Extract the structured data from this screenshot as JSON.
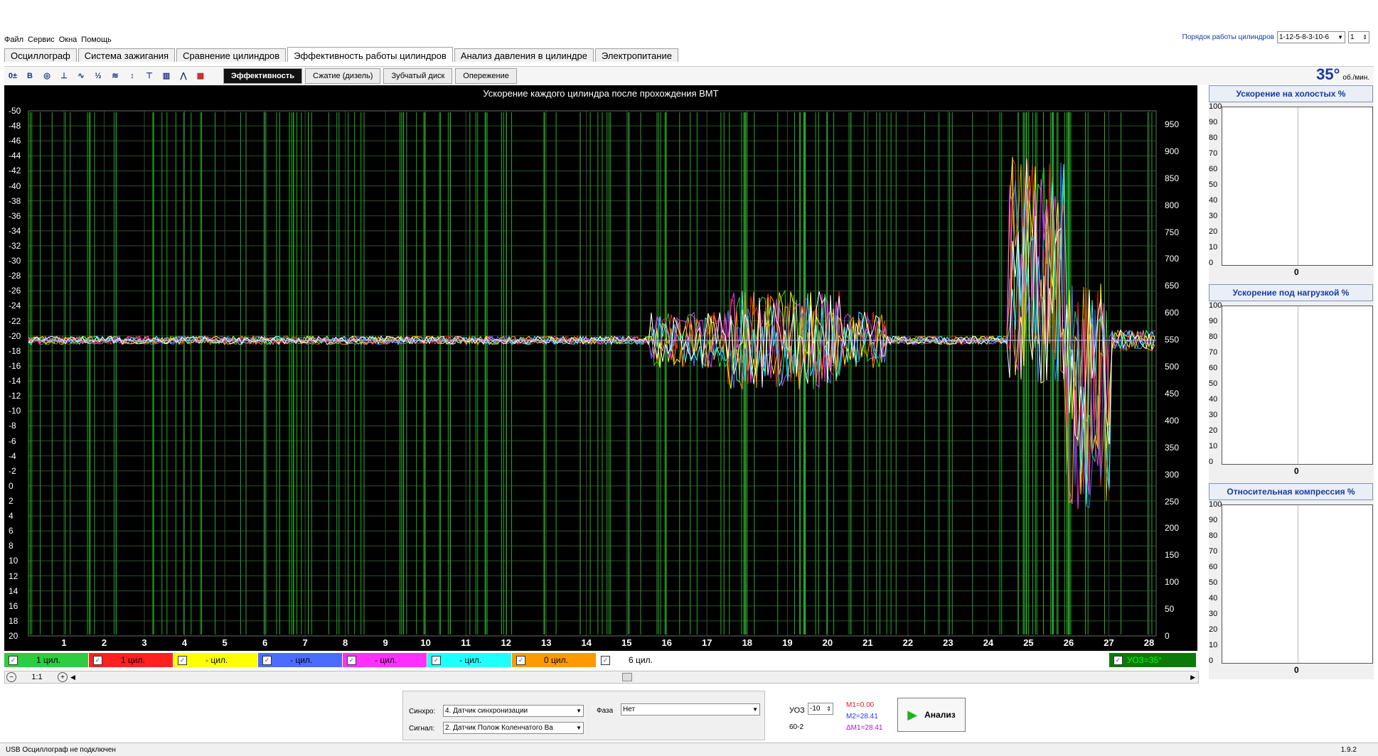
{
  "menu": [
    "Файл",
    "Сервис",
    "Окна",
    "Помощь"
  ],
  "cyl_order": {
    "label": "Порядок работы цилиндров",
    "value": "1-12-5-8-3-10-6",
    "spin": "1"
  },
  "tabs": [
    "Осциллограф",
    "Система зажигания",
    "Сравнение цилиндров",
    "Эффективность работы цилиндров",
    "Анализ давления в цилиндре",
    "Электропитание"
  ],
  "active_tab": 3,
  "subtabs": [
    "Эффективность",
    "Сжатие (дизель)",
    "Зубчатый диск",
    "Опережение"
  ],
  "angle": {
    "value": "35°",
    "unit": "об./мин."
  },
  "chart_data": {
    "type": "line",
    "title": "Ускорение каждого цилиндра после прохождения ВМТ",
    "x_ticks": [
      "1",
      "2",
      "3",
      "4",
      "5",
      "6",
      "7",
      "8",
      "9",
      "10",
      "11",
      "12",
      "13",
      "14",
      "15",
      "16",
      "17",
      "18",
      "19",
      "20",
      "21",
      "22",
      "23",
      "24",
      "25",
      "26",
      "27",
      "28"
    ],
    "left_ticks": [
      "-50",
      "-48",
      "-46",
      "-44",
      "-42",
      "-40",
      "-38",
      "-36",
      "-34",
      "-32",
      "-30",
      "-28",
      "-26",
      "-24",
      "-22",
      "-20",
      "-18",
      "-16",
      "-14",
      "-12",
      "-10",
      "-8",
      "-6",
      "-4",
      "-2",
      "0",
      "2",
      "4",
      "6",
      "8",
      "10",
      "12",
      "14",
      "16",
      "18",
      "20"
    ],
    "right_ticks": [
      "950",
      "900",
      "850",
      "800",
      "750",
      "700",
      "650",
      "600",
      "550",
      "500",
      "450",
      "400",
      "350",
      "300",
      "250",
      "200",
      "150",
      "100",
      "50",
      "0"
    ],
    "ylim_left": [
      -50,
      20
    ],
    "ylim_right": [
      0,
      975
    ],
    "grid": true,
    "series": [
      {
        "color": "#2ecc40"
      },
      {
        "color": "#ff2020"
      },
      {
        "color": "#ffff00"
      },
      {
        "color": "#4a6cff"
      },
      {
        "color": "#ff30ff"
      },
      {
        "color": "#20ffff"
      },
      {
        "color": "#ff9900"
      },
      {
        "color": "#ffffff"
      }
    ]
  },
  "channels": [
    {
      "label": "1 цил.",
      "bg": "#2ecc40",
      "fg": "#000000",
      "checked": true
    },
    {
      "label": "1 цил.",
      "bg": "#ff2020",
      "fg": "#000000",
      "checked": true
    },
    {
      "label": "- цил.",
      "bg": "#ffff00",
      "fg": "#000000",
      "checked": true
    },
    {
      "label": "- цил.",
      "bg": "#4a6cff",
      "fg": "#000000",
      "checked": true
    },
    {
      "label": "- цил.",
      "bg": "#ff30ff",
      "fg": "#000000",
      "checked": true
    },
    {
      "label": "- цил.",
      "bg": "#20ffff",
      "fg": "#000000",
      "checked": true
    },
    {
      "label": "0 цил.",
      "bg": "#ff9900",
      "fg": "#000000",
      "checked": true
    },
    {
      "label": "6 цил.",
      "bg": "#ffffff",
      "fg": "#000000",
      "checked": true
    }
  ],
  "uoz_channel": "УОЗ=35°",
  "zoom_label": "1:1",
  "panels": [
    {
      "title": "Ускорение на холостых %",
      "zero": "0"
    },
    {
      "title": "Ускорение под нагрузкой %",
      "zero": "0"
    },
    {
      "title": "Относительная компрессия %",
      "zero": "0"
    }
  ],
  "panel_ticks": [
    "100",
    "90",
    "80",
    "70",
    "60",
    "50",
    "40",
    "30",
    "20",
    "10",
    "0"
  ],
  "controls": {
    "sync_label": "Синхро:",
    "sync_value": "4. Датчик синхронизации",
    "signal_label": "Сигнал:",
    "signal_value": "2. Датчик Полож Коленчатого Ва",
    "phase_label": "Фаза",
    "phase_value": "Нет",
    "uoz_label": "УОЗ",
    "uoz_value": "-10",
    "gear": "60-2",
    "m1": "M1=0.00",
    "m2": "M2=28.41",
    "dm1": "ΔM1=28.41",
    "analyze": "Анализ"
  },
  "status": {
    "left": "USB Осциллограф не подключен",
    "version": "1.9.2"
  }
}
